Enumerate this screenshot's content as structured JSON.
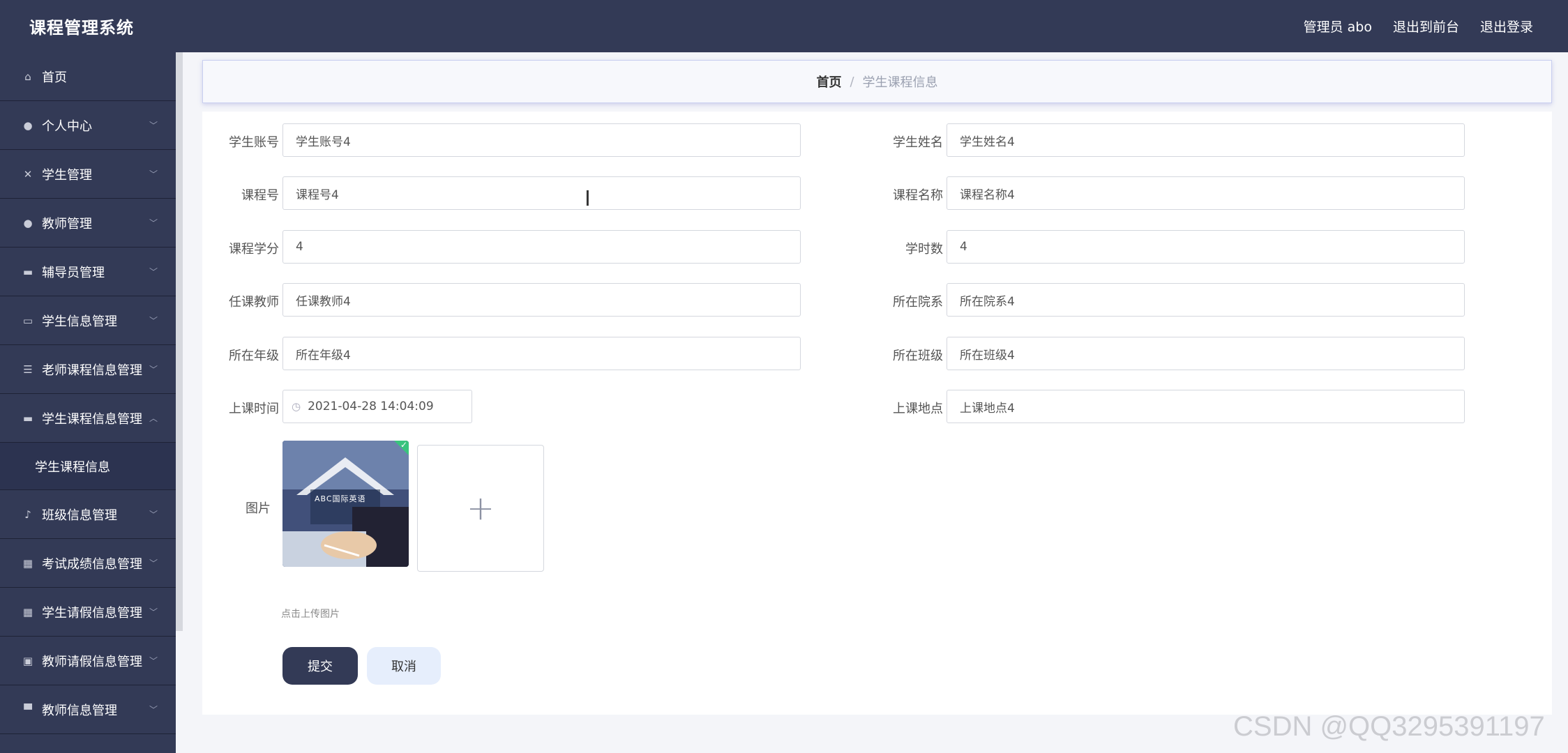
{
  "app": {
    "title": "课程管理系统"
  },
  "topbar": {
    "user_label": "管理员 abo",
    "front_link": "退出到前台",
    "logout_link": "退出登录"
  },
  "sidebar": {
    "items": [
      {
        "label": "首页",
        "icon": "home-icon",
        "glyph": "⌂",
        "expandable": false
      },
      {
        "label": "个人中心",
        "icon": "user-icon",
        "glyph": "●",
        "expandable": true
      },
      {
        "label": "学生管理",
        "icon": "students-icon",
        "glyph": "✕",
        "expandable": true
      },
      {
        "label": "教师管理",
        "icon": "teacher-icon",
        "glyph": "●",
        "expandable": true
      },
      {
        "label": "辅导员管理",
        "icon": "counselor-icon",
        "glyph": "▬",
        "expandable": true
      },
      {
        "label": "学生信息管理",
        "icon": "id-card-icon",
        "glyph": "▭",
        "expandable": true
      },
      {
        "label": "老师课程信息管理",
        "icon": "list-icon",
        "glyph": "☰",
        "expandable": true
      },
      {
        "label": "学生课程信息管理",
        "icon": "monitor-icon",
        "glyph": "▬",
        "expandable": true,
        "expanded": true,
        "sub": "学生课程信息"
      },
      {
        "label": "班级信息管理",
        "icon": "bell-icon",
        "glyph": "♪",
        "expandable": true
      },
      {
        "label": "考试成绩信息管理",
        "icon": "grid-icon",
        "glyph": "▦",
        "expandable": true
      },
      {
        "label": "学生请假信息管理",
        "icon": "table-icon",
        "glyph": "▦",
        "expandable": true
      },
      {
        "label": "教师请假信息管理",
        "icon": "clipboard-icon",
        "glyph": "▣",
        "expandable": true
      },
      {
        "label": "教师信息管理",
        "icon": "stand-icon",
        "glyph": "▀",
        "expandable": true
      }
    ]
  },
  "breadcrumb": {
    "home": "首页",
    "separator": "/",
    "current": "学生课程信息"
  },
  "form": {
    "student_account": {
      "label": "学生账号",
      "value": "学生账号4"
    },
    "student_name": {
      "label": "学生姓名",
      "value": "学生姓名4"
    },
    "course_no": {
      "label": "课程号",
      "value": "课程号4"
    },
    "course_name": {
      "label": "课程名称",
      "value": "课程名称4"
    },
    "credit": {
      "label": "课程学分",
      "value": "4"
    },
    "hours": {
      "label": "学时数",
      "value": "4"
    },
    "teacher": {
      "label": "任课教师",
      "value": "任课教师4"
    },
    "department": {
      "label": "所在院系",
      "value": "所在院系4"
    },
    "grade": {
      "label": "所在年级",
      "value": "所在年级4"
    },
    "class": {
      "label": "所在班级",
      "value": "所在班级4"
    },
    "class_time": {
      "label": "上课时间",
      "value": "2021-04-28 14:04:09"
    },
    "location": {
      "label": "上课地点",
      "value": "上课地点4"
    },
    "image": {
      "label": "图片",
      "tip": "点击上传图片",
      "thumb_text": "ABC国际英语"
    },
    "submit": "提交",
    "cancel": "取消"
  },
  "watermark": "CSDN @QQ3295391197",
  "colors": {
    "sidebar_bg": "#333a56",
    "page_bg": "#f4f5f9",
    "submit_bg": "#333a56",
    "cancel_bg": "#e6eefc",
    "upload_check": "#39c37d"
  }
}
